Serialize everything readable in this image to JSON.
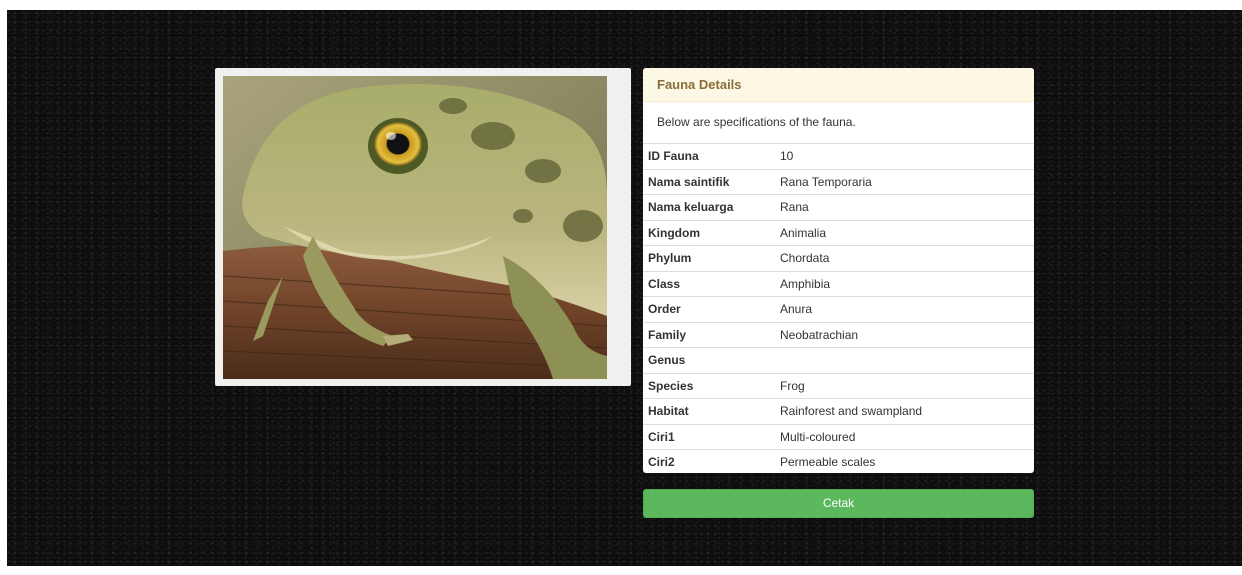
{
  "panel": {
    "heading": "Fauna Details",
    "description": "Below are specifications of the fauna."
  },
  "details": [
    {
      "key": "ID Fauna",
      "value": "10"
    },
    {
      "key": "Nama saintifik",
      "value": "Rana Temporaria"
    },
    {
      "key": "Nama keluarga",
      "value": "Rana"
    },
    {
      "key": "Kingdom",
      "value": "Animalia"
    },
    {
      "key": "Phylum",
      "value": "Chordata"
    },
    {
      "key": "Class",
      "value": "Amphibia"
    },
    {
      "key": "Order",
      "value": "Anura"
    },
    {
      "key": "Family",
      "value": "Neobatrachian"
    },
    {
      "key": "Genus",
      "value": ""
    },
    {
      "key": "Species",
      "value": "Frog"
    },
    {
      "key": "Habitat",
      "value": "Rainforest and swampland"
    },
    {
      "key": "Ciri1",
      "value": "Multi-coloured"
    },
    {
      "key": "Ciri2",
      "value": "Permeable scales"
    }
  ],
  "actions": {
    "print_label": "Cetak"
  },
  "colors": {
    "heading_bg": "#fcf8e3",
    "heading_text": "#8a6d3b",
    "button_bg": "#5cb85c",
    "page_bg": "#0d0d0d"
  },
  "image": {
    "subject": "frog photo"
  }
}
